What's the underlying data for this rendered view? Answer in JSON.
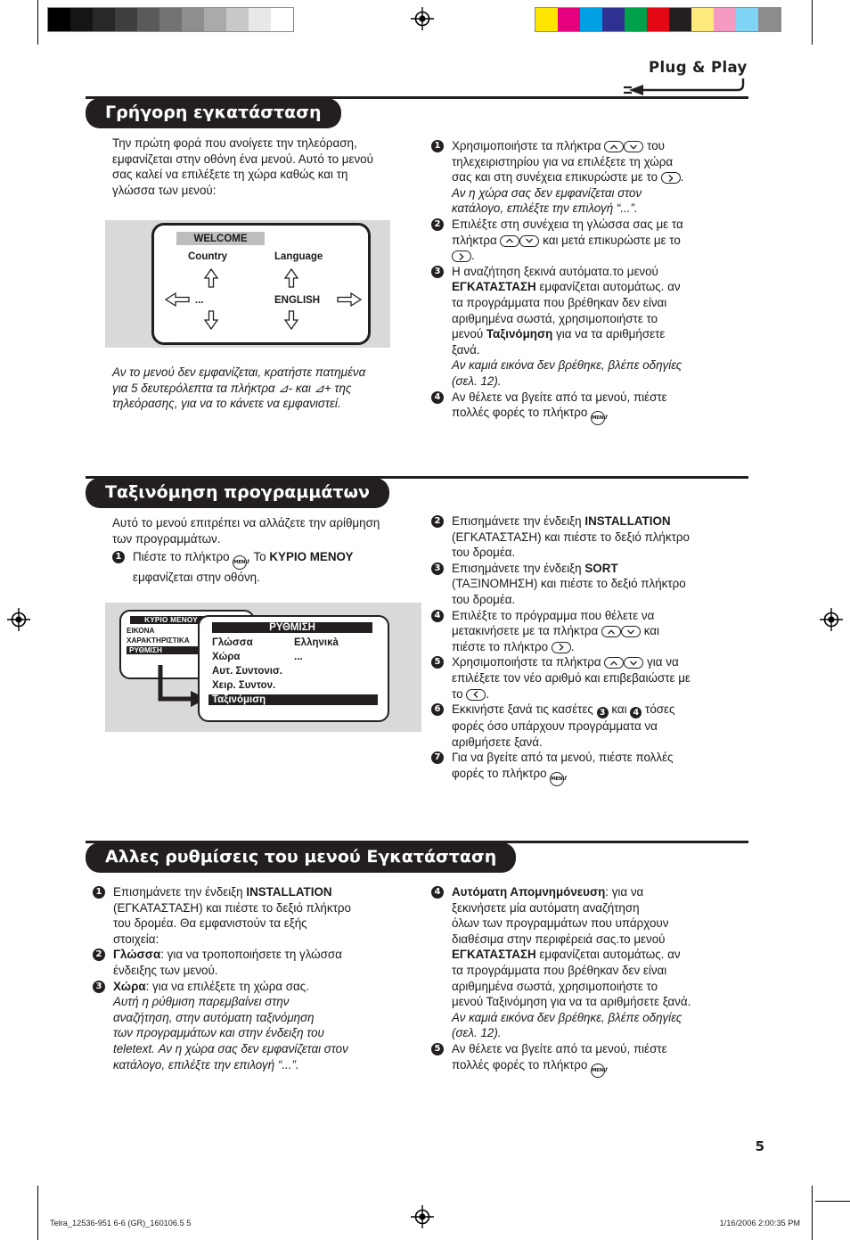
{
  "header": {
    "plug_play_label": "Plug & Play"
  },
  "calibration": {
    "gray_swatches": [
      "#000000",
      "#151515",
      "#282828",
      "#3f3f3f",
      "#5a5a5a",
      "#737373",
      "#8e8e8e",
      "#aaaaaa",
      "#c8c8c8",
      "#e8e8e8",
      "#ffffff"
    ],
    "color_swatches": [
      "#ffe600",
      "#e6007e",
      "#009fe3",
      "#2e3192",
      "#00a14b",
      "#e30613",
      "#231f20",
      "#fdea7b",
      "#f49ac1",
      "#7fd4f5",
      "#8c8c8c"
    ]
  },
  "sections": [
    {
      "title": "Γρήγορη εγκατάσταση",
      "intro": "Την πρώτη φορά που ανοίγετε την τηλεόραση, εμφανίζεται στην οθόνη ένα μενού. Αυτό το μενού σας καλεί να επιλέξετε τη χώρα καθώς και τη γλώσσα των μενού:",
      "note": "Αν το μενού δεν εμφανίζεται, κρατήστε πατημένα για 5 δευτερόλεπτα τα πλήκτρα ⊿- και ⊿+ της τηλεόρασης, για να το κάνετε να εμφανιστεί."
    },
    {
      "title": "Ταξινόμηση προγραμμάτων",
      "intro": "Αυτό το μενού επιτρέπει να αλλάζετε την αρίθμηση των προγραμμάτων."
    },
    {
      "title": "Αλλες ρυθμίσεις του μενού Εγκατάσταση"
    }
  ],
  "figure_welcome": {
    "title": "WELCOME",
    "country_label": "Country",
    "language_label": "Language",
    "country_value": "...",
    "language_value": "ENGLISH"
  },
  "figure_menu": {
    "main_title": "ΚΥΡΙΟ ΜΕΝΟΥ",
    "main_items": [
      "ΕΙΚΟΝΑ",
      "ΧΑΡΑΚΤΗΡΙΣΤΙΚΑ",
      "ΡΥΘΜΙΣΗ"
    ],
    "main_selected": "ΡΥΘΜΙΣΗ",
    "sub_title": "ΡΥΘΜΙΣΗ",
    "sub_rows": [
      {
        "label": "Γλώσσα",
        "value": "Ελληνικà"
      },
      {
        "label": "Χώρα",
        "value": "..."
      },
      {
        "label": "Αυτ. Συντονισ.",
        "value": ""
      },
      {
        "label": "Χειρ. Συντον.",
        "value": ""
      },
      {
        "label": "Ταξινόμιση",
        "value": ""
      }
    ],
    "sub_selected": "Ταξινόμιση"
  },
  "quick_install_steps": [
    {
      "num": "❶",
      "lines": [
        {
          "style": "plain",
          "pre": "Χρησιμοποιήστε τα πλήκτρα ",
          "keys": "up-down",
          "post": " του"
        },
        {
          "style": "plain",
          "text": "τηλεχειριστηρίου για να επιλέξετε τη χώρα"
        },
        {
          "style": "plain",
          "pre": "σας και στη συνέχεια επικυρώστε με το ",
          "keys": "right",
          "post": "."
        },
        {
          "style": "italic",
          "text": "Αν η χώρα σας δεν εμφανίζεται στον"
        },
        {
          "style": "italic",
          "text": "κατάλογο, επιλέξτε την επιλογή “...”."
        }
      ]
    },
    {
      "num": "❷",
      "lines": [
        {
          "style": "plain",
          "text": "Επιλέξτε στη συνέχεια τη γλώσσα σας με τα"
        },
        {
          "style": "plain",
          "pre": "πλήκτρα ",
          "keys": "up-down",
          "post": " και μετά επικυρώστε με το"
        },
        {
          "style": "plain",
          "pre": "",
          "keys": "right",
          "post": "."
        }
      ]
    },
    {
      "num": "❸",
      "lines": [
        {
          "style": "plain",
          "text": "Η αναζήτηση ξεκινά αυτόματα.το μενού"
        },
        {
          "style": "bold-mix",
          "bold": "ΕΓΚΑΤΑΣΤΑΣΗ",
          "post": " εμφανίζεται αυτομάτως. αν"
        },
        {
          "style": "plain",
          "text": "τα προγράμματα που βρέθηκαν δεν είναι"
        },
        {
          "style": "plain",
          "text": "αριθμημένα σωστά, χρησιμοποιήστε το"
        },
        {
          "style": "bold-mix2",
          "pre": "μενού ",
          "bold": "Ταξινόμηση",
          "post": " για να τα αριθμήσετε"
        },
        {
          "style": "plain",
          "text": "ξανά."
        },
        {
          "style": "italic",
          "text": "Αν καμιά εικόνα δεν βρέθηκε, βλέπε οδηγίες"
        },
        {
          "style": "italic",
          "text": "(σελ. 12)."
        }
      ]
    },
    {
      "num": "❹",
      "lines": [
        {
          "style": "plain",
          "text": "Αν θέλετε να βγείτε από τα μενού, πιέστε"
        },
        {
          "style": "plain",
          "pre": "πολλές φορές το πλήκτρο ",
          "keys": "menu",
          "post": "."
        }
      ]
    }
  ],
  "sort_left_step": {
    "num": "❶",
    "pre": "Πιέστε το πλήκτρο ",
    "keys": "menu",
    "mid": ". Το ",
    "bold": "ΚΥΡΙΟ ΜΕΝΟΥ",
    "post_line": "εμφανίζεται στην οθόνη."
  },
  "sort_steps": [
    {
      "num": "❷",
      "lines": [
        {
          "style": "bold-end",
          "pre": "Επισημάνετε την ένδειξη ",
          "bold": "INSTALLATION"
        },
        {
          "style": "plain",
          "text": "(ΕΓΚΑΤΑΣΤΑΣΗ) και πιέστε το δεξιό πλήκτρο"
        },
        {
          "style": "plain",
          "text": "του δρομέα."
        }
      ]
    },
    {
      "num": "❸",
      "lines": [
        {
          "style": "bold-end",
          "pre": "Επισημάνετε την ένδειξη ",
          "bold": "SORT"
        },
        {
          "style": "plain",
          "text": "(ΤΑΞΙΝΟΜΗΣΗ) και πιέστε το δεξιό πλήκτρο"
        },
        {
          "style": "plain",
          "text": "του δρομέα."
        }
      ]
    },
    {
      "num": "❹",
      "lines": [
        {
          "style": "plain",
          "text": "Επιλέξτε το πρόγραμμα που θέλετε να"
        },
        {
          "style": "plain",
          "pre": "μετακινήσετε με τα πλήκτρα ",
          "keys": "up-down",
          "post": " και"
        },
        {
          "style": "plain",
          "pre": "πιέστε το πλήκτρο ",
          "keys": "right",
          "post": "."
        }
      ]
    },
    {
      "num": "❺",
      "lines": [
        {
          "style": "plain",
          "pre": "Χρησιμοποιήστε τα πλήκτρα ",
          "keys": "up-down",
          "post": " για να"
        },
        {
          "style": "plain",
          "text": "επιλέξετε τον νέο αριθμό και επιβεβαιώστε με"
        },
        {
          "style": "plain",
          "pre": "το ",
          "keys": "left",
          "post": "."
        }
      ]
    },
    {
      "num": "❻",
      "lines": [
        {
          "style": "bullets",
          "pre": "Εκκινήστε ξανά τις κασέτες ",
          "b1": "❸",
          "mid": " και ",
          "b2": "❹",
          "post": " τόσες"
        },
        {
          "style": "plain",
          "text": "φορές όσο υπάρχουν προγράμματα να"
        },
        {
          "style": "plain",
          "text": "αριθμήσετε ξανά."
        }
      ]
    },
    {
      "num": "❼",
      "lines": [
        {
          "style": "plain",
          "text": "Για να βγείτε από τα μενού, πιέστε πολλές"
        },
        {
          "style": "plain",
          "pre": "φορές το πλήκτρο ",
          "keys": "menu",
          "post": "."
        }
      ]
    }
  ],
  "other_left_steps": [
    {
      "num": "❶",
      "lines": [
        {
          "style": "bold-end",
          "pre": "Επισημάνετε την ένδειξη ",
          "bold": "INSTALLATION"
        },
        {
          "style": "plain",
          "text": "(ΕΓΚΑΤΑΣΤΑΣΗ) και πιέστε το δεξιό πλήκτρο"
        },
        {
          "style": "plain",
          "text": "του δρομέα. Θα εμφανιστούν τα εξής"
        },
        {
          "style": "plain",
          "text": "στοιχεία:"
        }
      ]
    },
    {
      "num": "❷",
      "lines": [
        {
          "style": "bold-start",
          "bold": "Γλώσσα",
          "post": ": για να τροποποιήσετε τη γλώσσα"
        },
        {
          "style": "plain",
          "text": "ένδειξης των μενού."
        }
      ]
    },
    {
      "num": "❸",
      "lines": [
        {
          "style": "bold-start",
          "bold": "Χώρα",
          "post": ": για να επιλέξετε τη χώρα σας."
        },
        {
          "style": "italic",
          "text": "Αυτή η ρύθμιση παρεμβαίνει στην"
        },
        {
          "style": "italic",
          "text": "αναζήτηση, στην αυτόματη ταξινόμηση"
        },
        {
          "style": "italic",
          "text": "των προγραμμάτων και στην ένδειξη του"
        },
        {
          "style": "italic",
          "text": "teletext. Αν η χώρα σας δεν εμφανίζεται στον"
        },
        {
          "style": "italic",
          "text": "κατάλογο, επιλέξτε την επιλογή “...”."
        }
      ]
    }
  ],
  "other_right_steps": [
    {
      "num": "❹",
      "lines": [
        {
          "style": "bold-start",
          "bold": "Αυτόματη Απομνημόνευση",
          "post": ": για να"
        },
        {
          "style": "plain",
          "text": "ξεκινήσετε μία αυτόματη αναζήτηση"
        },
        {
          "style": "plain",
          "text": "όλων των προγραμμάτων που υπάρχουν"
        },
        {
          "style": "plain",
          "text": "διαθέσιμα στην περιφέρειά σας.το μενού"
        },
        {
          "style": "bold-mix",
          "bold": "ΕΓΚΑΤΑΣΤΑΣΗ",
          "post": " εμφανίζεται αυτομάτως. αν"
        },
        {
          "style": "plain",
          "text": "τα προγράμματα που βρέθηκαν δεν είναι"
        },
        {
          "style": "plain",
          "text": "αριθμημένα σωστά, χρησιμοποιήστε το"
        },
        {
          "style": "plain",
          "text": "μενού Ταξινόμηση για να τα αριθμήσετε ξανά."
        },
        {
          "style": "italic",
          "text": "Αν καμιά εικόνα δεν βρέθηκε, βλέπε οδηγίες"
        },
        {
          "style": "italic",
          "text": "(σελ. 12)."
        }
      ]
    },
    {
      "num": "❺",
      "lines": [
        {
          "style": "plain",
          "text": "Αν θέλετε να βγείτε από τα μενού, πιέστε"
        },
        {
          "style": "plain",
          "pre": "πολλές φορές το πλήκτρο ",
          "keys": "menu",
          "post": "."
        }
      ]
    }
  ],
  "footer": {
    "page_number": "5",
    "file_info": "Telra_12536-951 6-6 (GR)_160106.5   5",
    "timestamp": "1/16/2006   2:00:35 PM"
  }
}
